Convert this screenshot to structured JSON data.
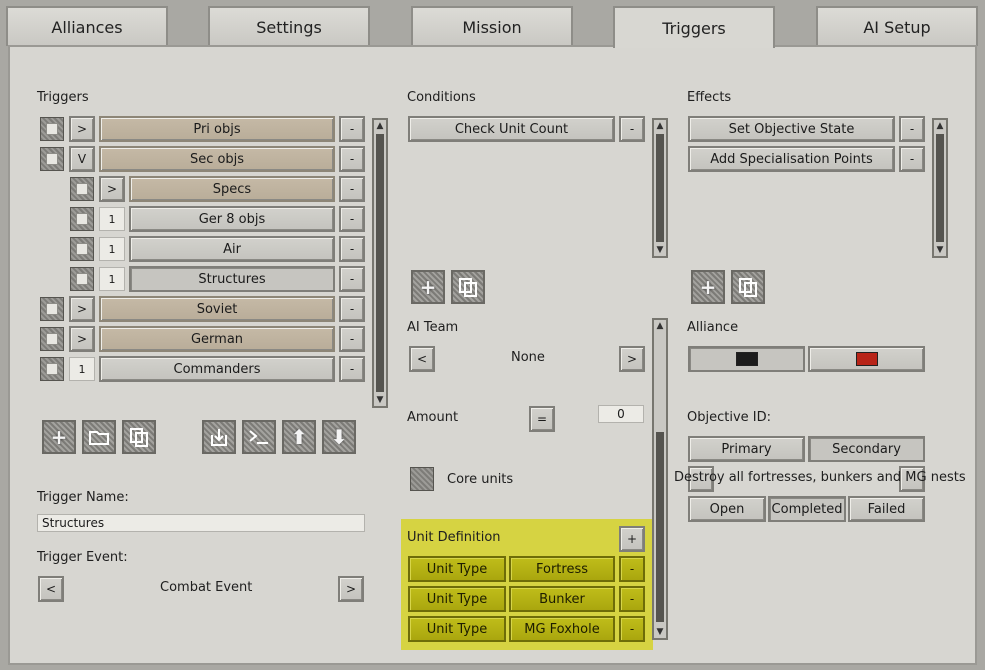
{
  "tabs": [
    "Alliances",
    "Settings",
    "Mission",
    "Triggers",
    "AI Setup"
  ],
  "active_tab": "Triggers",
  "triggers": {
    "header": "Triggers",
    "rows": [
      {
        "toggle": ">",
        "label": "Pri objs",
        "minus": "-"
      },
      {
        "toggle": "V",
        "label": "Sec objs",
        "minus": "-"
      },
      {
        "toggle": ">",
        "label": "Specs",
        "minus": "-"
      },
      {
        "toggle": "1",
        "label": "Ger 8 objs",
        "minus": "-"
      },
      {
        "toggle": "1",
        "label": "Air",
        "minus": "-"
      },
      {
        "toggle": "1",
        "label": "Structures",
        "minus": "-"
      },
      {
        "toggle": ">",
        "label": "Soviet",
        "minus": "-"
      },
      {
        "toggle": ">",
        "label": "German",
        "minus": "-"
      },
      {
        "toggle": "1",
        "label": "Commanders",
        "minus": "-"
      }
    ],
    "trigger_name_label": "Trigger Name:",
    "trigger_name_value": "Structures",
    "trigger_event_label": "Trigger Event:",
    "trigger_event_value": "Combat Event",
    "prev": "<",
    "next": ">"
  },
  "conditions": {
    "header": "Conditions",
    "items": [
      "Check Unit Count"
    ],
    "minus": "-",
    "ai_team_label": "AI Team",
    "ai_team_value": "None",
    "prev": "<",
    "next": ">",
    "amount_label": "Amount",
    "amount_op": "=",
    "amount_value": "0",
    "core_units_label": "Core units",
    "unit_definition_label": "Unit Definition",
    "plus": "+",
    "unit_rows": [
      {
        "type": "Unit Type",
        "value": "Fortress"
      },
      {
        "type": "Unit Type",
        "value": "Bunker"
      },
      {
        "type": "Unit Type",
        "value": "MG Foxhole"
      }
    ]
  },
  "effects": {
    "header": "Effects",
    "items": [
      "Set Objective State",
      "Add Specialisation Points"
    ],
    "minus": "-",
    "alliance_label": "Alliance",
    "alliance_colors": [
      "#1c1c1c",
      "#b82418"
    ],
    "objective_id_label": "Objective ID:",
    "objective_types": [
      "Primary",
      "Secondary"
    ],
    "objective_text": "Destroy all fortresses, bunkers and MG nests",
    "states": [
      "Open",
      "Completed",
      "Failed"
    ]
  },
  "colors": {
    "highlight": "#d6d33a",
    "panel": "#d7d6d1"
  }
}
